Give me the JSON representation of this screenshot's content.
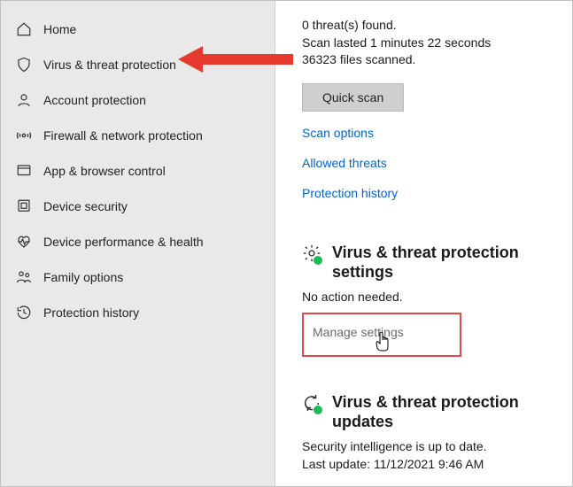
{
  "sidebar": {
    "items": [
      {
        "label": "Home"
      },
      {
        "label": "Virus & threat protection"
      },
      {
        "label": "Account protection"
      },
      {
        "label": "Firewall & network protection"
      },
      {
        "label": "App & browser control"
      },
      {
        "label": "Device security"
      },
      {
        "label": "Device performance & health"
      },
      {
        "label": "Family options"
      },
      {
        "label": "Protection history"
      }
    ]
  },
  "scan": {
    "threats": "0 threat(s) found.",
    "duration": "Scan lasted 1 minutes 22 seconds",
    "files": "36323 files scanned.",
    "quick_scan_label": "Quick scan",
    "links": {
      "scan_options": "Scan options",
      "allowed_threats": "Allowed threats",
      "protection_history": "Protection history"
    }
  },
  "settings_section": {
    "title": "Virus & threat protection settings",
    "subtitle": "No action needed.",
    "manage_link": "Manage settings"
  },
  "updates_section": {
    "title": "Virus & threat protection updates",
    "subtitle": "Security intelligence is up to date.",
    "last_update": "Last update: 11/12/2021 9:46 AM"
  }
}
